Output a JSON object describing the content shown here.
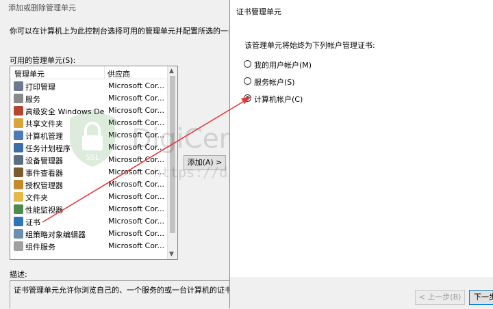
{
  "back_dialog": {
    "title": "添加或删除管理单元",
    "description": "你可以在计算机上为此控制台选择可用的管理单元并配置所选的一组管",
    "available_label": "可用的管理单元(S):",
    "columns": {
      "name": "管理单元",
      "vendor": "供应商"
    },
    "items": [
      {
        "name": "打印管理",
        "vendor": "Microsoft Cor...",
        "icon": "printer-icon"
      },
      {
        "name": "服务",
        "vendor": "Microsoft Cor...",
        "icon": "gears-icon"
      },
      {
        "name": "高级安全 Windows De...",
        "vendor": "Microsoft Cor...",
        "icon": "firewall-icon"
      },
      {
        "name": "共享文件夹",
        "vendor": "Microsoft Cor...",
        "icon": "shared-folder-icon"
      },
      {
        "name": "计算机管理",
        "vendor": "Microsoft Cor...",
        "icon": "computer-management-icon"
      },
      {
        "name": "任务计划程序",
        "vendor": "Microsoft Cor...",
        "icon": "clock-icon"
      },
      {
        "name": "设备管理器",
        "vendor": "Microsoft Cor...",
        "icon": "device-manager-icon"
      },
      {
        "name": "事件查看器",
        "vendor": "Microsoft Cor...",
        "icon": "event-viewer-icon"
      },
      {
        "name": "授权管理器",
        "vendor": "Microsoft Cor...",
        "icon": "authorization-icon"
      },
      {
        "name": "文件夹",
        "vendor": "Microsoft Cor...",
        "icon": "folder-icon"
      },
      {
        "name": "性能监视器",
        "vendor": "Microsoft Cor...",
        "icon": "performance-icon"
      },
      {
        "name": "证书",
        "vendor": "Microsoft Cor...",
        "icon": "certificate-icon"
      },
      {
        "name": "组策略对象编辑器",
        "vendor": "Microsoft Cor...",
        "icon": "group-policy-icon"
      },
      {
        "name": "组件服务",
        "vendor": "Microsoft Cor...",
        "icon": "component-services-icon"
      }
    ],
    "add_button": "添加(A) >",
    "desc_label": "描述:",
    "desc_text": "证书管理单元允许你浏览自己的、一个服务的或一台计算机的证书存储"
  },
  "front_dialog": {
    "title": "证书管理单元",
    "prompt": "该管理单元将始终为下列帐户管理证书:",
    "options": [
      {
        "label": "我的用户帐户(M)",
        "checked": false
      },
      {
        "label": "服务帐户(S)",
        "checked": false
      },
      {
        "label": "计算机帐户(C)",
        "checked": true
      }
    ],
    "prev_button": "< 上一步(B)",
    "next_button": "下一步"
  },
  "watermark": {
    "main": "DigiCert证书评测网",
    "url": "https://digicert.idcspy.com/",
    "shield_text": "SSL"
  },
  "colors": {
    "arrow": "#e8363a",
    "selection_border": "#0078d7"
  }
}
